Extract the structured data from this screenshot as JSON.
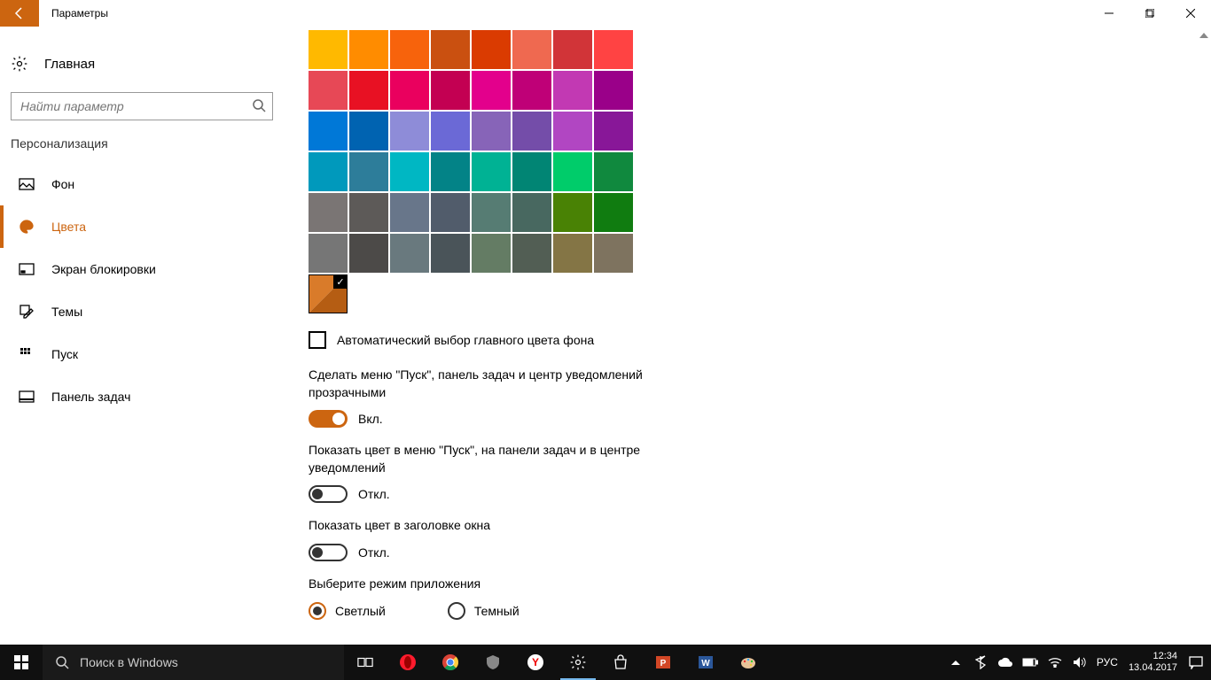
{
  "window": {
    "title": "Параметры"
  },
  "sidebar": {
    "home": "Главная",
    "search_placeholder": "Найти параметр",
    "section": "Персонализация",
    "items": [
      {
        "label": "Фон"
      },
      {
        "label": "Цвета"
      },
      {
        "label": "Экран блокировки"
      },
      {
        "label": "Темы"
      },
      {
        "label": "Пуск"
      },
      {
        "label": "Панель задач"
      }
    ]
  },
  "colors": {
    "palette": [
      [
        "#ffb900",
        "#ff8c00",
        "#f7630c",
        "#ca5010",
        "#da3b01",
        "#ef6950",
        "#d13438",
        "#ff4343"
      ],
      [
        "#e74856",
        "#e81123",
        "#ea005e",
        "#c30052",
        "#e3008c",
        "#bf0077",
        "#c239b3",
        "#9a0089"
      ],
      [
        "#0078d7",
        "#0063b1",
        "#8e8cd8",
        "#6b69d6",
        "#8764b8",
        "#744da9",
        "#b146c2",
        "#881798"
      ],
      [
        "#0099bc",
        "#2d7d9a",
        "#00b7c3",
        "#038387",
        "#00b294",
        "#018574",
        "#00cc6a",
        "#10893e"
      ],
      [
        "#7a7574",
        "#5d5a58",
        "#68768a",
        "#515c6b",
        "#567c73",
        "#486860",
        "#498205",
        "#107c10"
      ],
      [
        "#767676",
        "#4c4a48",
        "#69797e",
        "#4a5459",
        "#647c64",
        "#525e54",
        "#847545",
        "#7e735f"
      ]
    ],
    "auto_label": "Автоматический выбор главного цвета фона",
    "transparency": {
      "label": "Сделать меню \"Пуск\", панель задач и центр уведомлений прозрачными",
      "state": "Вкл.",
      "on": true
    },
    "show_color": {
      "label": "Показать цвет в меню \"Пуск\", на панели задач и в центре уведомлений",
      "state": "Откл.",
      "on": false
    },
    "titlebar_color": {
      "label": "Показать цвет в заголовке окна",
      "state": "Откл.",
      "on": false
    },
    "app_mode": {
      "label": "Выберите режим приложения",
      "light": "Светлый",
      "dark": "Темный"
    }
  },
  "taskbar": {
    "search": "Поиск в Windows",
    "lang": "РУС",
    "time": "12:34",
    "date": "13.04.2017"
  }
}
